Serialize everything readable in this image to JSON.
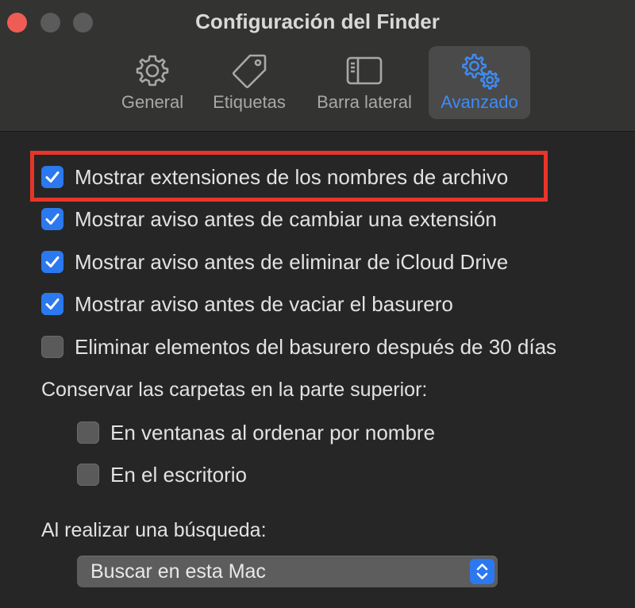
{
  "window": {
    "title": "Configuración del Finder"
  },
  "toolbar": {
    "tabs": [
      {
        "label": "General",
        "icon": "gear-icon",
        "active": false
      },
      {
        "label": "Etiquetas",
        "icon": "tag-icon",
        "active": false
      },
      {
        "label": "Barra lateral",
        "icon": "sidebar-icon",
        "active": false
      },
      {
        "label": "Avanzado",
        "icon": "gears-icon",
        "active": true
      }
    ]
  },
  "options": [
    {
      "label": "Mostrar extensiones de los nombres de archivo",
      "checked": true,
      "highlighted": true
    },
    {
      "label": "Mostrar aviso antes de cambiar una extensión",
      "checked": true
    },
    {
      "label": "Mostrar aviso antes de eliminar de iCloud Drive",
      "checked": true
    },
    {
      "label": "Mostrar aviso antes de vaciar el basurero",
      "checked": true
    },
    {
      "label": "Eliminar elementos del basurero después de 30 días",
      "checked": false
    }
  ],
  "folders_on_top": {
    "label": "Conservar las carpetas en la parte superior:",
    "options": [
      {
        "label": "En ventanas al ordenar por nombre",
        "checked": false
      },
      {
        "label": "En el escritorio",
        "checked": false
      }
    ]
  },
  "search": {
    "label": "Al realizar una búsqueda:",
    "selected": "Buscar en esta Mac"
  },
  "colors": {
    "accent": "#2c78ef",
    "active_tab_label": "#3e8cf6",
    "highlight_border": "#e8352a",
    "traffic_close": "#ee5d55"
  }
}
